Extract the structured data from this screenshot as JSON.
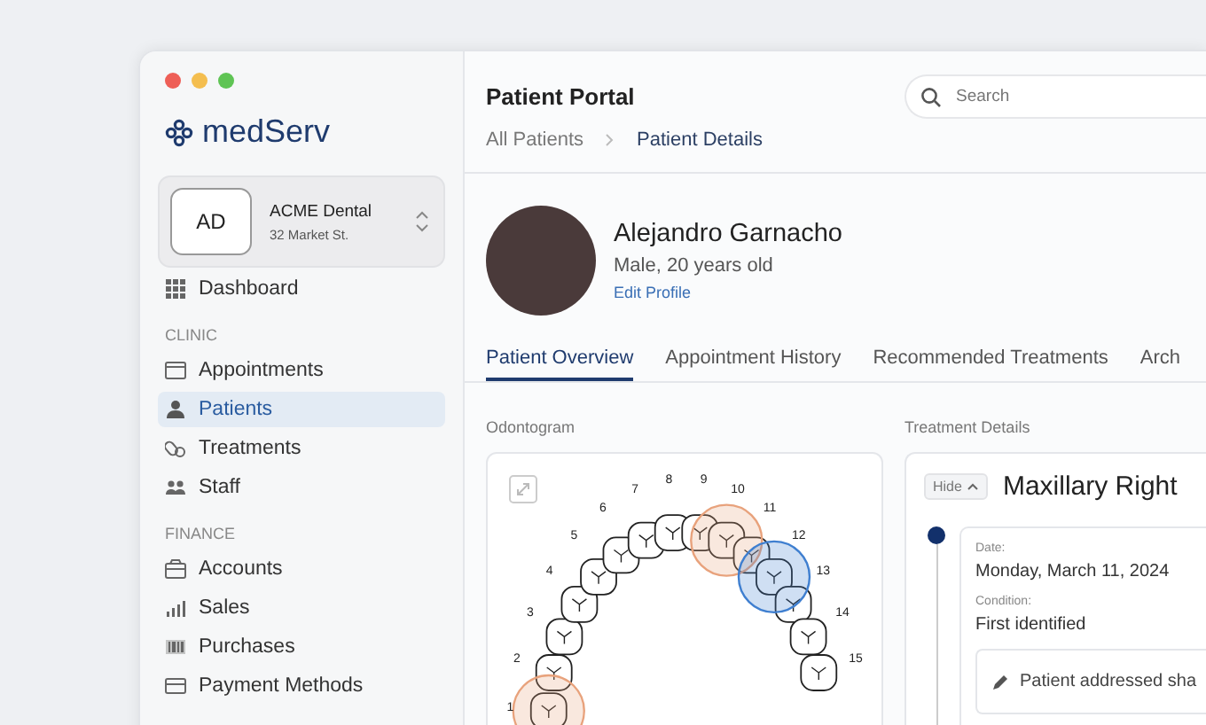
{
  "window": {
    "controls": [
      {
        "color": "#ee5f57"
      },
      {
        "color": "#f4be4f"
      },
      {
        "color": "#5fc454"
      }
    ]
  },
  "sidebar": {
    "brand": "medServ",
    "clinic_switcher": {
      "initials": "AD",
      "name": "ACME Dental",
      "address": "32 Market St."
    },
    "items": [
      {
        "label": "Dashboard",
        "selected": false
      }
    ],
    "sections": [
      {
        "heading": "CLINIC",
        "items": [
          {
            "label": "Appointments",
            "selected": false
          },
          {
            "label": "Patients",
            "selected": true
          },
          {
            "label": "Treatments",
            "selected": false
          },
          {
            "label": "Staff",
            "selected": false
          }
        ]
      },
      {
        "heading": "FINANCE",
        "items": [
          {
            "label": "Accounts",
            "selected": false
          },
          {
            "label": "Sales",
            "selected": false
          },
          {
            "label": "Purchases",
            "selected": false
          },
          {
            "label": "Payment Methods",
            "selected": false
          }
        ]
      }
    ]
  },
  "header": {
    "title": "Patient Portal",
    "search": {
      "placeholder": "Search"
    },
    "breadcrumb": [
      {
        "label": "All Patients",
        "selected": false
      },
      {
        "label": "Patient Details",
        "selected": true
      }
    ]
  },
  "patient": {
    "name": "Alejandro Garnacho",
    "details": "Male, 20 years old",
    "edit_link": "Edit Profile"
  },
  "tabs": [
    {
      "label": "Patient Overview",
      "selected": true
    },
    {
      "label": "Appointment History",
      "selected": false
    },
    {
      "label": "Recommended Treatments",
      "selected": false
    },
    {
      "label": "Arch",
      "selected": false
    }
  ],
  "odontogram": {
    "heading": "Odontogram",
    "teeth": [
      {
        "number": "1",
        "color": "#e8a27c"
      },
      {
        "number": "2"
      },
      {
        "number": "3"
      },
      {
        "number": "4"
      },
      {
        "number": "5"
      },
      {
        "number": "6"
      },
      {
        "number": "7"
      },
      {
        "number": "8"
      },
      {
        "number": "9"
      },
      {
        "number": "10",
        "color": "#e8a27c"
      },
      {
        "number": "11"
      },
      {
        "number": "12",
        "color": "#3f7fd0"
      },
      {
        "number": "13"
      },
      {
        "number": "14"
      },
      {
        "number": "15"
      }
    ]
  },
  "treatment": {
    "heading": "Treatment Details",
    "toggle": "Hide",
    "title": "Maxillary Right",
    "entry": {
      "date_label": "Date:",
      "date": "Monday, March 11, 2024",
      "condition_label": "Condition:",
      "condition": "First identified",
      "note": "Patient addressed sha"
    }
  }
}
